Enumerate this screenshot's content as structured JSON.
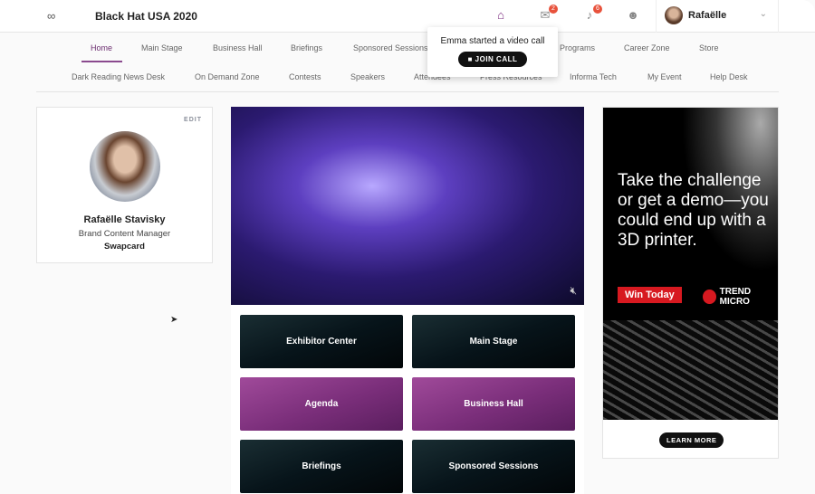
{
  "header": {
    "logo_icon": "infinity-icon",
    "title": "Black Hat USA 2020",
    "chat_badge": "2",
    "notif_badge": "6",
    "user_name": "Rafaëlle"
  },
  "nav_row1": [
    "Home",
    "Main Stage",
    "Business Hall",
    "Briefings",
    "Sponsored Sessions",
    "Programs",
    "Career Zone",
    "Store"
  ],
  "nav_row2": [
    "Dark Reading News Desk",
    "On Demand Zone",
    "Contests",
    "Speakers",
    "Attendees",
    "Press Resources",
    "Informa Tech",
    "My Event",
    "Help Desk"
  ],
  "active_tab": "Home",
  "popup": {
    "message": "Emma started a video call",
    "button": "JOIN CALL"
  },
  "profile": {
    "edit": "EDIT",
    "name": "Rafaëlle Stavisky",
    "role": "Brand Content Manager",
    "company": "Swapcard"
  },
  "tiles": [
    "Exhibitor Center",
    "Main Stage",
    "Agenda",
    "Business Hall",
    "Briefings",
    "Sponsored Sessions"
  ],
  "ad": {
    "headline": "Take the challenge or get a demo—you could end up with a 3D printer.",
    "cta": "Win Today",
    "brand": "TREND MICRO",
    "learn_more": "LEARN MORE"
  },
  "colors": {
    "accent": "#6b2d6f",
    "badge": "#e8523c",
    "ad_red": "#d71920"
  }
}
